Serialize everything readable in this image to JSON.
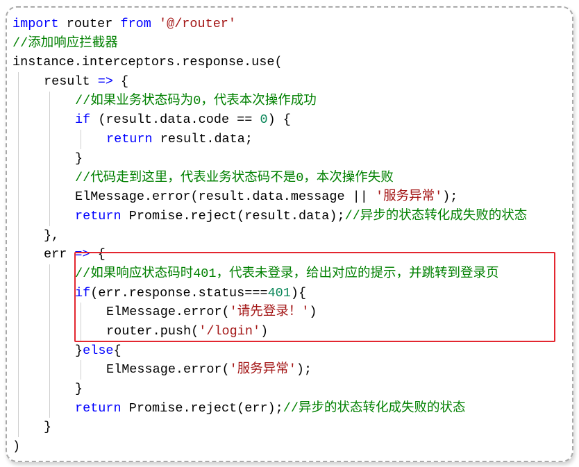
{
  "code_lines": [
    {
      "i": 0,
      "parts": [
        [
          "kw",
          "import"
        ],
        [
          "p",
          " router "
        ],
        [
          "kw",
          "from"
        ],
        [
          "p",
          " "
        ],
        [
          "str",
          "'@/router'"
        ]
      ]
    },
    {
      "i": 0,
      "parts": [
        [
          "cm",
          "//添加响应拦截器"
        ]
      ]
    },
    {
      "i": 0,
      "parts": [
        [
          "p",
          "instance.interceptors.response.use("
        ]
      ]
    },
    {
      "i": 1,
      "parts": [
        [
          "p",
          "result "
        ],
        [
          "op",
          "=>"
        ],
        [
          "p",
          " {"
        ]
      ]
    },
    {
      "i": 2,
      "parts": [
        [
          "cm",
          "//如果业务状态码为0，代表本次操作成功"
        ]
      ]
    },
    {
      "i": 2,
      "parts": [
        [
          "kw",
          "if"
        ],
        [
          "p",
          " (result.data.code == "
        ],
        [
          "num",
          "0"
        ],
        [
          "p",
          ") {"
        ]
      ]
    },
    {
      "i": 3,
      "parts": [
        [
          "kw",
          "return"
        ],
        [
          "p",
          " result.data;"
        ]
      ]
    },
    {
      "i": 2,
      "parts": [
        [
          "p",
          "}"
        ]
      ]
    },
    {
      "i": 2,
      "parts": [
        [
          "cm",
          "//代码走到这里，代表业务状态码不是0，本次操作失败"
        ]
      ]
    },
    {
      "i": 2,
      "parts": [
        [
          "p",
          "ElMessage.error(result.data.message || "
        ],
        [
          "str",
          "'服务异常'"
        ],
        [
          "p",
          ");"
        ]
      ]
    },
    {
      "i": 2,
      "parts": [
        [
          "kw",
          "return"
        ],
        [
          "p",
          " Promise.reject(result.data);"
        ],
        [
          "cm",
          "//异步的状态转化成失败的状态"
        ]
      ]
    },
    {
      "i": 1,
      "parts": [
        [
          "p",
          "},"
        ]
      ]
    },
    {
      "i": 1,
      "parts": [
        [
          "p",
          "err "
        ],
        [
          "op",
          "=>"
        ],
        [
          "p",
          " {"
        ]
      ]
    },
    {
      "i": 2,
      "parts": [
        [
          "cm",
          "//如果响应状态码时401，代表未登录，给出对应的提示，并跳转到登录页"
        ]
      ]
    },
    {
      "i": 2,
      "parts": [
        [
          "kw",
          "if"
        ],
        [
          "p",
          "(err.response.status==="
        ],
        [
          "num",
          "401"
        ],
        [
          "p",
          "){"
        ]
      ]
    },
    {
      "i": 3,
      "parts": [
        [
          "p",
          "ElMessage.error("
        ],
        [
          "str",
          "'请先登录！'"
        ],
        [
          "p",
          ")"
        ]
      ]
    },
    {
      "i": 3,
      "parts": [
        [
          "p",
          "router.push("
        ],
        [
          "str",
          "'/login'"
        ],
        [
          "p",
          ")"
        ]
      ]
    },
    {
      "i": 2,
      "parts": [
        [
          "p",
          "}"
        ],
        [
          "kw",
          "else"
        ],
        [
          "p",
          "{"
        ]
      ]
    },
    {
      "i": 3,
      "parts": [
        [
          "p",
          "ElMessage.error("
        ],
        [
          "str",
          "'服务异常'"
        ],
        [
          "p",
          ");"
        ]
      ]
    },
    {
      "i": 2,
      "parts": [
        [
          "p",
          "}"
        ]
      ]
    },
    {
      "i": 2,
      "parts": [
        [
          "kw",
          "return"
        ],
        [
          "p",
          " Promise.reject(err);"
        ],
        [
          "cm",
          "//异步的状态转化成失败的状态"
        ]
      ]
    },
    {
      "i": 1,
      "parts": [
        [
          "p",
          "}"
        ]
      ]
    },
    {
      "i": 0,
      "parts": [
        [
          "p",
          ")"
        ]
      ]
    }
  ],
  "colors": {
    "keyword": "#0000ff",
    "comment": "#008000",
    "string": "#a31515",
    "number": "#098658",
    "highlight_border": "#e3262f"
  }
}
